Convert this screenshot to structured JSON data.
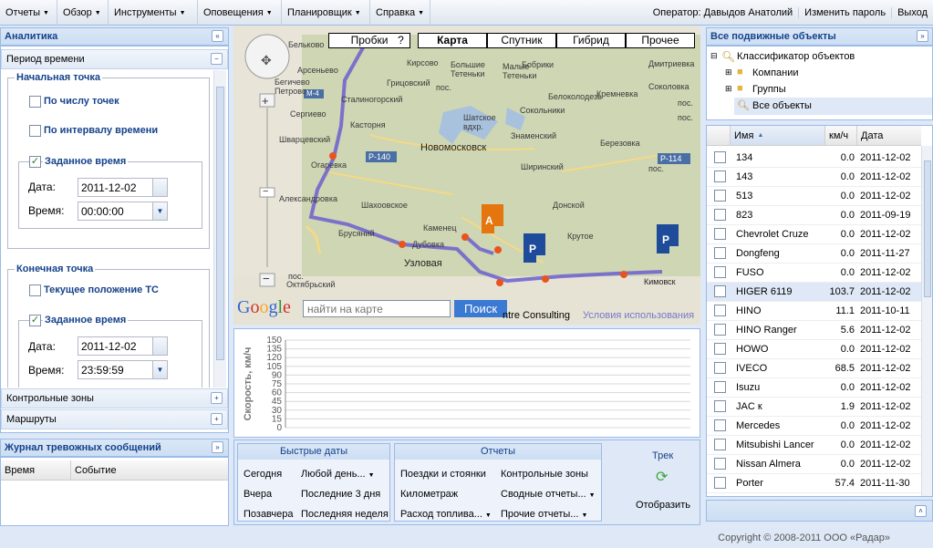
{
  "topmenu": {
    "items": [
      "Отчеты",
      "Обзор",
      "Инструменты",
      "Оповещения",
      "Планировщик",
      "Справка"
    ],
    "operator": "Оператор: Давыдов Анатолий",
    "change_password": "Изменить пароль",
    "logout": "Выход"
  },
  "analytics": {
    "title": "Аналитика",
    "period": "Период времени",
    "start": {
      "legend": "Начальная точка",
      "by_points": "По числу точек",
      "by_interval": "По интервалу времени",
      "set_time": "Заданное время",
      "date_label": "Дата:",
      "date": "2011-12-02",
      "time_label": "Время:",
      "time": "00:00:00"
    },
    "end": {
      "legend": "Конечная точка",
      "current": "Текущее положение ТС",
      "set_time": "Заданное время",
      "date_label": "Дата:",
      "date": "2011-12-02",
      "time_label": "Время:",
      "time": "23:59:59"
    },
    "control_zones": "Контрольные зоны",
    "routes": "Маршруты"
  },
  "alarms": {
    "title": "Журнал тревожных сообщений",
    "col_time": "Время",
    "col_event": "Событие"
  },
  "map": {
    "traffic": "Пробки",
    "help": "?",
    "map": "Карта",
    "satellite": "Спутник",
    "hybrid": "Гибрид",
    "other": "Прочее",
    "google": "Google",
    "search_placeholder": "найти на карте",
    "search_btn": "Поиск",
    "terms": "Условия использования",
    "copyright": "ntre Consulting",
    "towns_small": [
      "Бельково",
      "Арсеньево",
      "Бегичево",
      "Петрово",
      "Сергиево",
      "Шварцевский",
      "Огаревка",
      "Александровка",
      "Шахоовское",
      "Брусяний",
      "Каменец",
      "Дубовка",
      "пос.",
      "Октябрьский",
      "Сталиногорский",
      "Касторня",
      "Кирсово",
      "Большие Тетеньки",
      "Малые Тетеньки",
      "Грицовский",
      "пос.",
      "Шатское вдхр.",
      "Сокольники",
      "Знаменский",
      "Ширинский",
      "Донской",
      "Крутое",
      "Бобрики",
      "Белоколодезь",
      "Дмитриевка",
      "Соколовка",
      "пос.",
      "пос.",
      "пос.",
      "Кремневка",
      "Березовка"
    ],
    "towns_big": [
      "Новомосковск",
      "Узловая",
      "Кимовск"
    ],
    "roads": [
      "М-4",
      "Р-140",
      "Р-114"
    ]
  },
  "chart_data": {
    "type": "line",
    "ylabel": "Скорость, км/ч",
    "yticks": [
      0,
      15,
      30,
      45,
      60,
      75,
      90,
      105,
      120,
      135,
      150
    ],
    "ylim": [
      0,
      150
    ],
    "grid": "horizontal"
  },
  "quick_dates": {
    "title": "Быстрые даты",
    "today": "Сегодня",
    "any_day": "Любой день...",
    "yesterday": "Вчера",
    "last3": "Последние 3 дня",
    "day_before": "Позавчера",
    "last_week": "Последняя неделя"
  },
  "reports": {
    "title": "Отчеты",
    "trips": "Поездки и стоянки",
    "control_zones": "Контрольные зоны",
    "mileage": "Километраж",
    "summary": "Сводные отчеты...",
    "fuel": "Расход топлива...",
    "other": "Прочие отчеты..."
  },
  "track": {
    "title": "Трек",
    "show": "Отобразить"
  },
  "objects": {
    "title": "Все подвижные объекты",
    "root": "Классификатор объектов",
    "companies": "Компании",
    "groups": "Группы",
    "all": "Все объекты",
    "col_name": "Имя",
    "col_speed": "км/ч",
    "col_date": "Дата",
    "rows": [
      {
        "name": "134",
        "speed": "0.0",
        "date": "2011-12-02"
      },
      {
        "name": "143",
        "speed": "0.0",
        "date": "2011-12-02"
      },
      {
        "name": "513",
        "speed": "0.0",
        "date": "2011-12-02"
      },
      {
        "name": "823",
        "speed": "0.0",
        "date": "2011-09-19"
      },
      {
        "name": "Chevrolet Cruze",
        "speed": "0.0",
        "date": "2011-12-02"
      },
      {
        "name": "Dongfeng",
        "speed": "0.0",
        "date": "2011-11-27"
      },
      {
        "name": "FUSO",
        "speed": "0.0",
        "date": "2011-12-02"
      },
      {
        "name": "HIGER 6119",
        "speed": "103.7",
        "date": "2011-12-02"
      },
      {
        "name": "HINO",
        "speed": "11.1",
        "date": "2011-10-11"
      },
      {
        "name": "HINO Ranger",
        "speed": "5.6",
        "date": "2011-12-02"
      },
      {
        "name": "HOWO",
        "speed": "0.0",
        "date": "2011-12-02"
      },
      {
        "name": "IVECO",
        "speed": "68.5",
        "date": "2011-12-02"
      },
      {
        "name": "Isuzu",
        "speed": "0.0",
        "date": "2011-12-02"
      },
      {
        "name": "JAC к",
        "speed": "1.9",
        "date": "2011-12-02"
      },
      {
        "name": "Mercedes",
        "speed": "0.0",
        "date": "2011-12-02"
      },
      {
        "name": "Mitsubishi Lancer",
        "speed": "0.0",
        "date": "2011-12-02"
      },
      {
        "name": "Nissan Almera",
        "speed": "0.0",
        "date": "2011-12-02"
      },
      {
        "name": "Porter",
        "speed": "57.4",
        "date": "2011-11-30"
      }
    ]
  },
  "footer": {
    "copyright": "Copyright © 2008-2011 ООО «Радар»"
  }
}
